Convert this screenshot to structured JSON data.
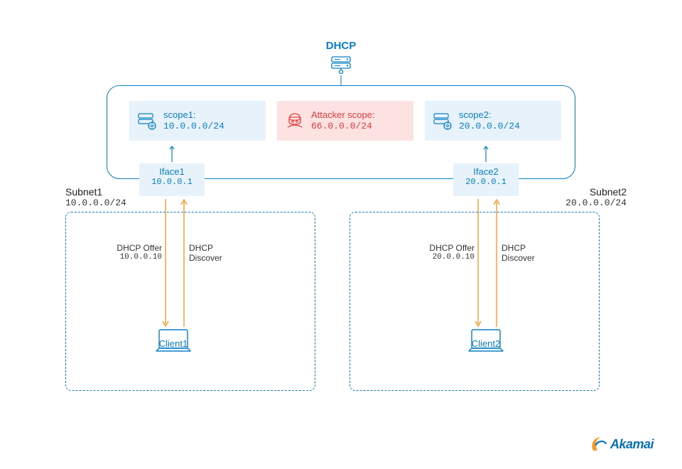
{
  "header": {
    "dhcp_label": "DHCP"
  },
  "scopes": {
    "scope1": {
      "title": "scope1:",
      "ip": "10.0.0.0/24"
    },
    "attacker": {
      "title": "Attacker scope:",
      "ip": "66.0.0.0/24"
    },
    "scope2": {
      "title": "scope2:",
      "ip": "20.0.0.0/24"
    }
  },
  "ifaces": {
    "iface1": {
      "name": "Iface1",
      "ip": "10.0.0.1"
    },
    "iface2": {
      "name": "Iface2",
      "ip": "20.0.0.1"
    }
  },
  "subnets": {
    "subnet1": {
      "name": "Subnet1",
      "ip": "10.0.0.0/24"
    },
    "subnet2": {
      "name": "Subnet2",
      "ip": "20.0.0.0/24"
    }
  },
  "exchange": {
    "offer1": {
      "title": "DHCP Offer",
      "ip": "10.0.0.10"
    },
    "discover1": {
      "title": "DHCP",
      "sub": "Discover"
    },
    "offer2": {
      "title": "DHCP Offer",
      "ip": "20.0.0.10"
    },
    "discover2": {
      "title": "DHCP",
      "sub": "Discover"
    }
  },
  "clients": {
    "client1": "Client1",
    "client2": "Client2"
  },
  "brand": {
    "name": "Akamai"
  },
  "colors": {
    "blue": "#0a7fc4",
    "lightblue_bg": "#e8f2fa",
    "red": "#e73c3c",
    "lightred_bg": "#fde2e2",
    "orange": "#f39a2a"
  }
}
